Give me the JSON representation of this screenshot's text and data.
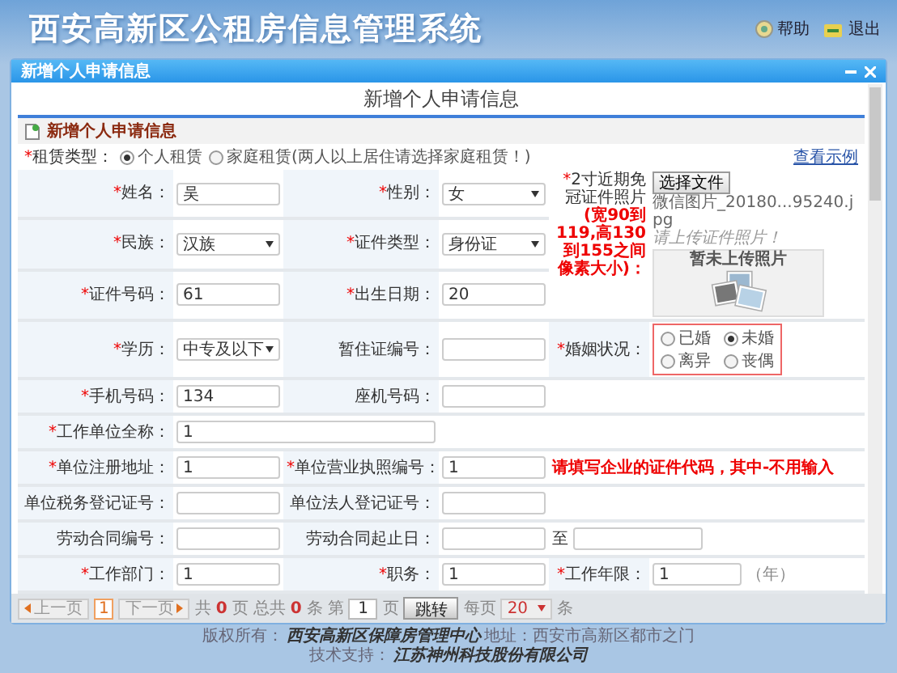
{
  "app_title": "西安高新区公租房信息管理系统",
  "header_links": [
    {
      "label": "帮助",
      "kind": "help"
    },
    {
      "label": "退出",
      "kind": "exit"
    }
  ],
  "dialog": {
    "title": "新增个人申请信息"
  },
  "form_title": "新增个人申请信息",
  "section_title": "新增个人申请信息",
  "rental_type": {
    "mark": "*",
    "label": "租赁类型：",
    "options": [
      {
        "label": "个人租赁",
        "selected": true
      },
      {
        "label": "家庭租赁(两人以上居住请选择家庭租赁！)",
        "selected": false
      }
    ]
  },
  "view_example": "查看示例",
  "rows": [
    {
      "left": {
        "mark": "*",
        "label": "姓名：",
        "kind": "text",
        "value": "吴"
      },
      "right": {
        "mark": "*",
        "label": "性别：",
        "kind": "select",
        "value": "女"
      },
      "side": {
        "kind": "photo",
        "mark": "*",
        "label": "2寸近期免冠证件照片",
        "note": "(宽90到119,高130到155之间像素大小)：",
        "button": "选择文件",
        "file": "微信图片_20180...95240.jpg",
        "hint": "请上传证件照片！",
        "empty": "暂未上传照片"
      }
    },
    {
      "left": {
        "mark": "*",
        "label": "民族：",
        "kind": "select",
        "value": "汉族"
      },
      "right": {
        "mark": "*",
        "label": "证件类型：",
        "kind": "select",
        "value": "身份证"
      }
    },
    {
      "left": {
        "mark": "*",
        "label": "证件号码：",
        "kind": "text",
        "value": "61"
      },
      "right": {
        "mark": "*",
        "label": "出生日期：",
        "kind": "text",
        "value": "20"
      }
    },
    {
      "left": {
        "mark": "*",
        "label": "学历：",
        "kind": "select",
        "value": "中专及以下"
      },
      "right": {
        "label": "暂住证编号：",
        "kind": "text"
      },
      "side": {
        "kind": "marital",
        "mark": "*",
        "label": "婚姻状况：",
        "options": [
          {
            "label": "已婚",
            "selected": false
          },
          {
            "label": "未婚",
            "selected": true
          },
          {
            "label": "离异",
            "selected": false
          },
          {
            "label": "丧偶",
            "selected": false
          }
        ]
      }
    },
    {
      "left": {
        "mark": "*",
        "label": "手机号码：",
        "kind": "text",
        "value": "134"
      },
      "right": {
        "label": "座机号码：",
        "kind": "text"
      }
    },
    {
      "left": {
        "mark": "*",
        "label": "工作单位全称：",
        "kind": "wide",
        "value": "1"
      }
    },
    {
      "left": {
        "mark": "*",
        "label": "单位注册地址：",
        "kind": "text",
        "value": "1"
      },
      "right": {
        "mark": "*",
        "label": "单位营业执照编号：",
        "kind": "text",
        "value": "1"
      },
      "side": {
        "kind": "note",
        "text": "请填写企业的证件代码，其中-不用输入"
      }
    },
    {
      "left": {
        "label": "单位税务登记证号：",
        "kind": "text"
      },
      "right": {
        "label": "单位法人登记证号：",
        "kind": "text"
      }
    },
    {
      "left": {
        "label": "劳动合同编号：",
        "kind": "text"
      },
      "right": {
        "label": "劳动合同起止日：",
        "kind": "text"
      },
      "side": {
        "kind": "range",
        "sep": "至"
      }
    },
    {
      "left": {
        "mark": "*",
        "label": "工作部门：",
        "kind": "text",
        "value": "1"
      },
      "right": {
        "mark": "*",
        "label": "职务：",
        "kind": "text",
        "value": "1"
      },
      "side": {
        "kind": "field",
        "mark": "*",
        "label": "工作年限：",
        "value": "1",
        "unit": "（年）"
      }
    }
  ],
  "pager": {
    "prev": "上一页",
    "current": "1",
    "next": "下一页",
    "pages_pre": "共",
    "pages": "0",
    "pages_post": "页",
    "total_pre": "总共",
    "total": "0",
    "total_post": "条",
    "goto_pre": "第",
    "goto": "1",
    "goto_post": "页",
    "jump": "跳转",
    "size_pre": "每页",
    "size": "20",
    "size_post": "条"
  },
  "footer": {
    "line1_label": "版权所有：",
    "owner": "西安高新区保障房管理中心",
    "address": "地址：西安市高新区都市之门",
    "line2_label": "技术支持：",
    "support": "江苏神州科技股份有限公司"
  }
}
